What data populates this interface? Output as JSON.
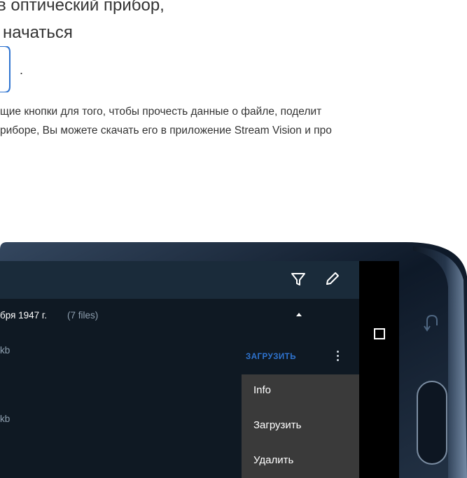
{
  "text": {
    "line1": "в оптический прибор,",
    "line2": "начаться",
    "period": ".",
    "paragraph_line1": "щие кнопки для того, чтобы прочесть данные о файле, поделит",
    "paragraph_line2": "риборе, Вы можете скачать его в приложение Stream Vision и про"
  },
  "app": {
    "toolbar": {
      "filter_icon": "filter-icon",
      "edit_icon": "pencil-icon"
    },
    "group": {
      "title": "бря 1947 г.",
      "count": "(7 files)",
      "caret": "caret-up-icon"
    },
    "files": [
      {
        "name": "kb"
      },
      {
        "name": "kb"
      },
      {
        "name": ""
      }
    ],
    "file_action": {
      "download_label": "ЗАГРУЗИТЬ",
      "more_icon": "more-vert-icon"
    }
  },
  "context_menu": {
    "items": [
      {
        "label": "Info"
      },
      {
        "label": "Загрузить"
      },
      {
        "label": "Удалить"
      }
    ]
  },
  "navbar": {
    "recents_icon": "recents-icon"
  },
  "colors": {
    "toolbar": "#1a2b3a",
    "app_bg": "#0f1923",
    "accent_blue": "#2f74d0",
    "menu_bg": "#3a3a3a"
  }
}
